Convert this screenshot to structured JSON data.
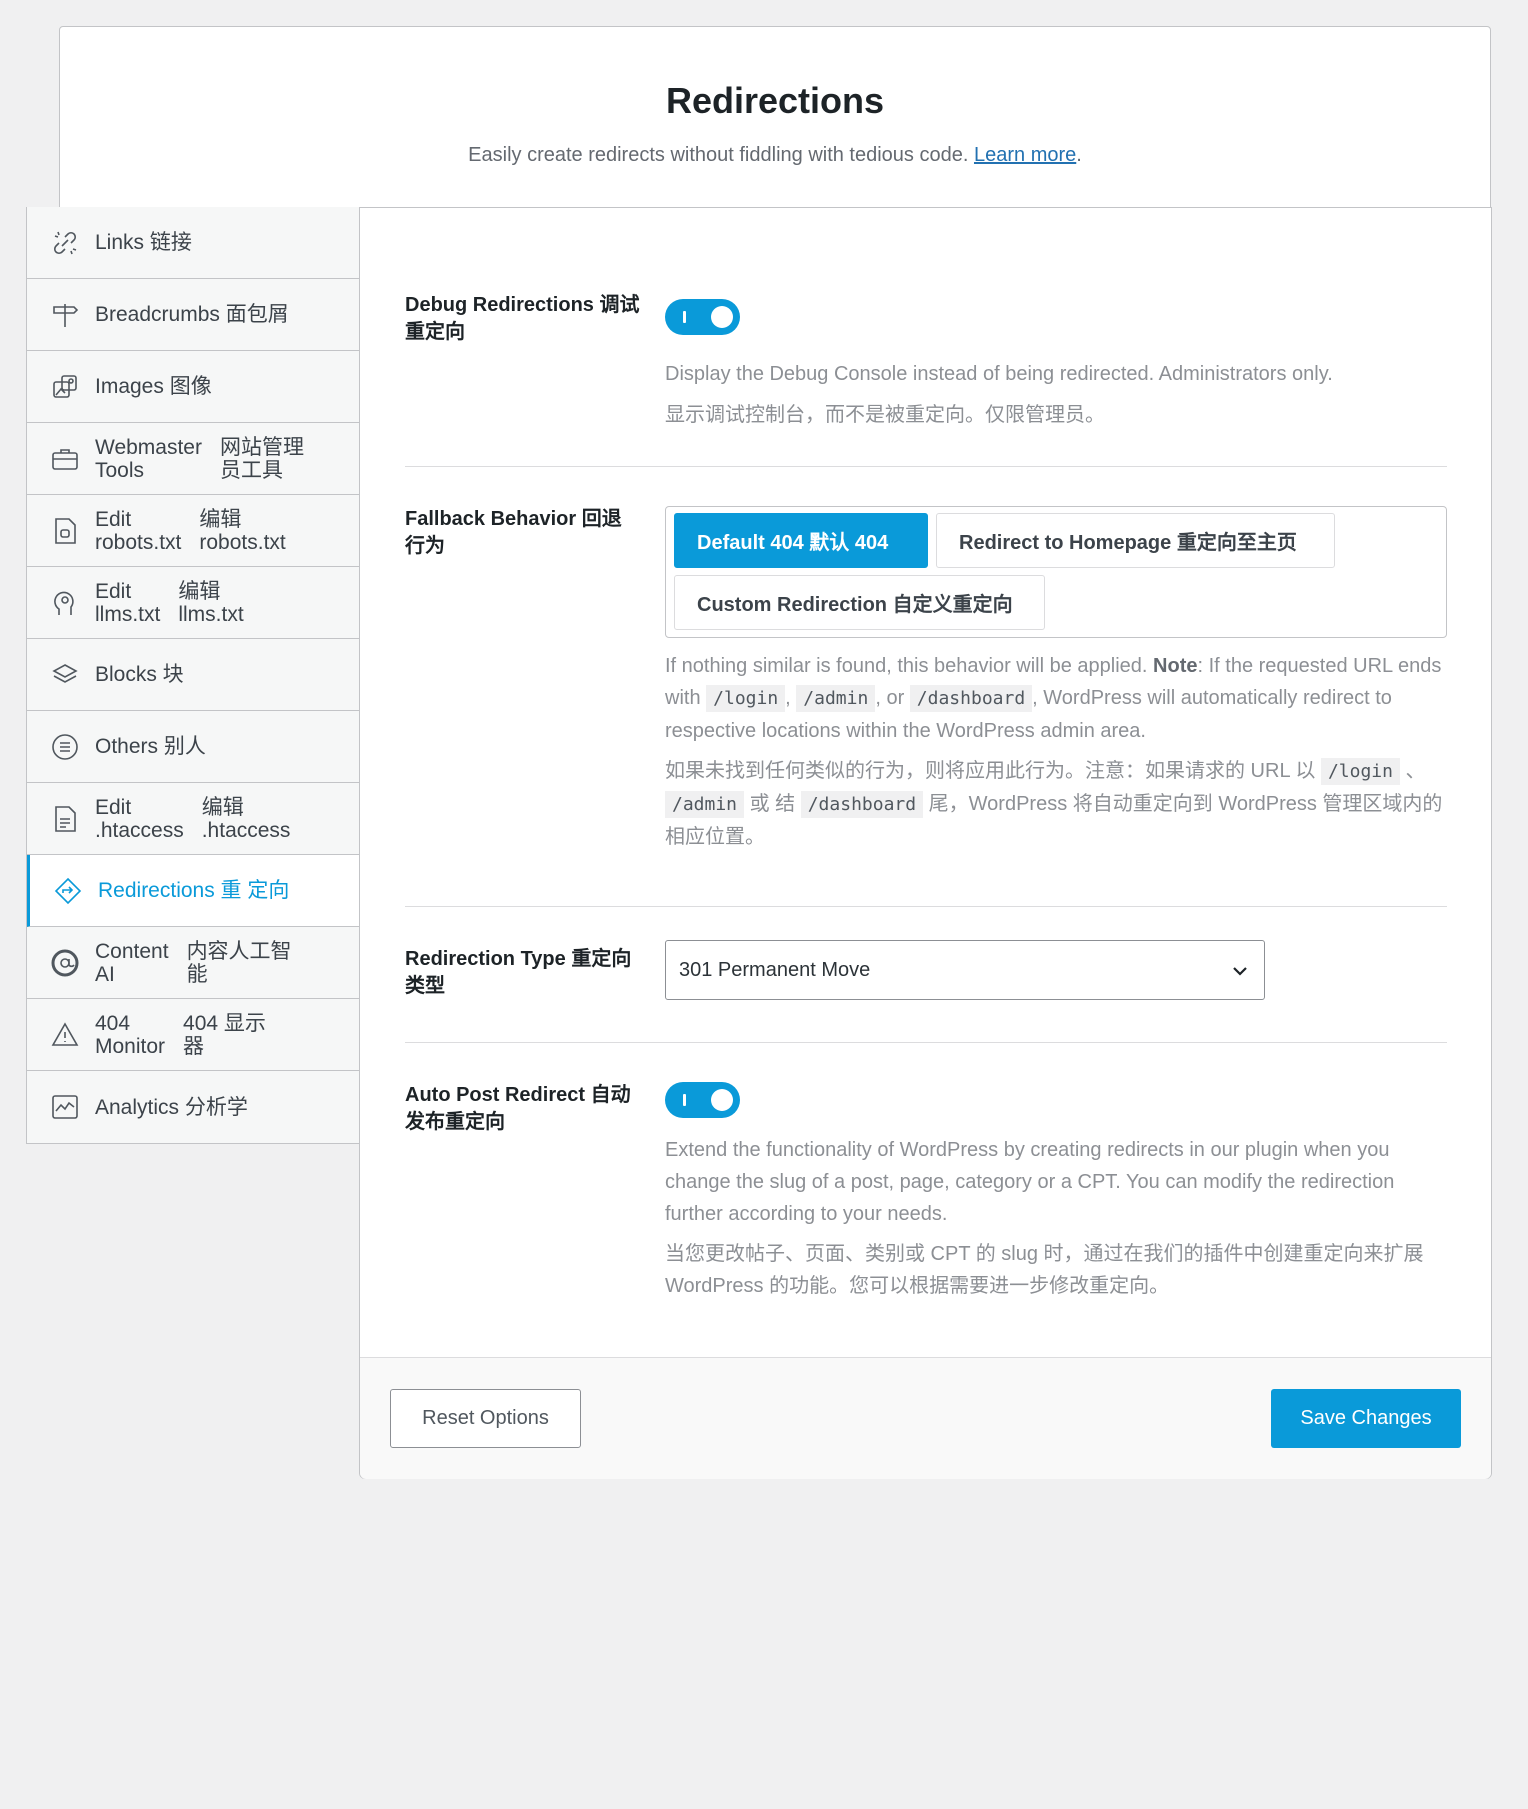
{
  "header": {
    "title": "Redirections",
    "subtitle": "Easily create redirects without fiddling with tedious code.",
    "learn_more": "Learn more",
    "period": "."
  },
  "sidebar": {
    "items": [
      {
        "label": "Links  链接",
        "icon": "links-icon"
      },
      {
        "label": "Breadcrumbs  面包屑",
        "icon": "breadcrumbs-icon"
      },
      {
        "label": "Images  图像",
        "icon": "images-icon"
      },
      {
        "label_a": "Webmaster\nTools",
        "label_b": "网站管理\n员工具",
        "icon": "briefcase-icon"
      },
      {
        "label_a": "Edit\nrobots.txt",
        "label_b": "编辑\nrobots.txt",
        "icon": "robots-file-icon"
      },
      {
        "label_a": "Edit\nllms.txt",
        "label_b": "编辑\nllms.txt",
        "icon": "llms-icon"
      },
      {
        "label": "Blocks  块",
        "icon": "blocks-icon"
      },
      {
        "label": "Others  别人",
        "icon": "others-icon"
      },
      {
        "label_a": "Edit\n.htaccess",
        "label_b": "编辑\n.htaccess",
        "icon": "htaccess-file-icon"
      },
      {
        "label": "Redirections  重 定向",
        "icon": "redirections-icon",
        "active": true
      },
      {
        "label_a": "Content\nAI",
        "label_b": "内容人工智\n能",
        "icon": "content-ai-icon"
      },
      {
        "label_a": "404\nMonitor",
        "label_b": "404 显示\n器",
        "icon": "warning-icon"
      },
      {
        "label": "Analytics  分析学",
        "icon": "analytics-icon"
      }
    ]
  },
  "settings": {
    "debug": {
      "label": "Debug Redirections  调试重定向",
      "enabled": true,
      "desc_en": "Display the Debug Console instead of being redirected. Administrators only.",
      "desc_zh": "显示调试控制台，而不是被重定向。仅限管理员。"
    },
    "fallback": {
      "label": "Fallback Behavior  回退行为",
      "options": [
        "Default 404  默认 404",
        "Redirect to Homepage  重定向至主页",
        "Custom Redirection  自定义重定向"
      ],
      "selected": "Default 404  默认 404",
      "desc_en_1": "If nothing similar is found, this behavior will be applied.",
      "note": "Note",
      "desc_en_2": ": If the requested URL ends with",
      "code_login": "/login",
      "code_admin": "/admin",
      "code_dashboard": "/dashboard",
      "comma": ",",
      "or": ", or",
      "desc_en_3": ", WordPress will automatically redirect to respective locations within the WordPress admin area.",
      "desc_zh_1": "如果未找到任何类似的行为，则将应用此行为。注意：如果请求的 URL 以",
      "desc_zh_2": "、",
      "desc_zh_3": "或 结",
      "desc_zh_4": "尾，WordPress 将自动重定向到 WordPress 管理区域内的相应位置。"
    },
    "redirection_type": {
      "label": "Redirection Type  重定向类型",
      "value": "301 Permanent Move"
    },
    "auto_post": {
      "label": "Auto Post Redirect  自动发布重定向",
      "enabled": true,
      "desc_en": "Extend the functionality of WordPress by creating redirects in our plugin when you change the slug of a post, page, category or a CPT. You can modify the redirection further according to your needs.",
      "desc_zh": "当您更改帖子、页面、类别或 CPT 的 slug 时，通过在我们的插件中创建重定向来扩展 WordPress 的功能。您可以根据需要进一步修改重定向。"
    }
  },
  "footer": {
    "reset_label": "Reset Options",
    "save_label": "Save Changes"
  },
  "colors": {
    "accent": "#0a9ad9",
    "link": "#2271b1"
  }
}
